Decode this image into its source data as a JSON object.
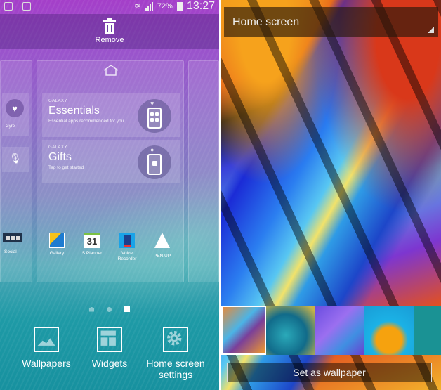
{
  "left_screen": {
    "status_bar": {
      "icons_left": [
        "sim-alert-icon",
        "gallery-notification-icon"
      ],
      "wifi": "wifi-icon",
      "signal": "signal-icon",
      "battery_percent": "72%",
      "battery": "battery-icon",
      "time": "13:27"
    },
    "remove_label": "Remove",
    "widgets": [
      {
        "brand": "GALAXY",
        "title": "Essentials",
        "subtitle": "Essential apps recommended for you"
      },
      {
        "brand": "GALAXY",
        "title": "Gifts",
        "subtitle": "Tap to get started"
      }
    ],
    "side_page": {
      "health_label": "Gyro"
    },
    "apps": [
      {
        "label": "Social"
      },
      {
        "label": "Gallery"
      },
      {
        "label": "S Planner",
        "icon_text": "31"
      },
      {
        "label": "Voice Recorder"
      },
      {
        "label": "PEN.UP"
      }
    ],
    "page_indicators": [
      "home",
      "page",
      "page-active"
    ],
    "options": [
      {
        "label": "Wallpapers"
      },
      {
        "label": "Widgets"
      },
      {
        "label": "Home screen settings"
      }
    ]
  },
  "right_screen": {
    "dropdown_title": "Home screen",
    "thumbnails_count": 5,
    "selected_thumbnail": 1,
    "set_button": "Set as wallpaper"
  }
}
